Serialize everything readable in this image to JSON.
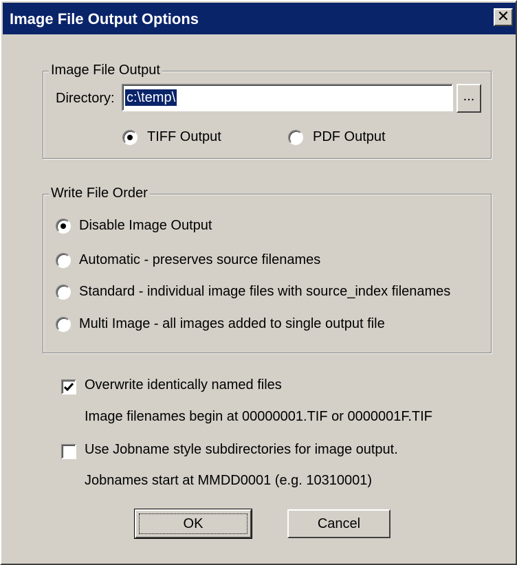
{
  "window": {
    "title": "Image File Output Options",
    "close_glyph": "✕"
  },
  "output_group": {
    "legend": "Image File Output",
    "directory_label": "Directory:",
    "directory_value": "c:\\temp\\",
    "browse_label": "...",
    "format_options": [
      {
        "label": "TIFF Output",
        "checked": true
      },
      {
        "label": "PDF Output",
        "checked": false
      }
    ]
  },
  "order_group": {
    "legend": "Write File Order",
    "options": [
      {
        "label": "Disable Image Output",
        "checked": true
      },
      {
        "label": "Automatic - preserves source filenames",
        "checked": false
      },
      {
        "label": "Standard - individual image files with source_index filenames",
        "checked": false
      },
      {
        "label": "Multi Image - all images added to single output file",
        "checked": false
      }
    ]
  },
  "overwrite": {
    "label": "Overwrite identically named files",
    "checked": true,
    "note": "Image filenames begin at 00000001.TIF or 0000001F.TIF"
  },
  "jobname": {
    "label": "Use Jobname style subdirectories for image output.",
    "checked": false,
    "note": "Jobnames start at MMDD0001 (e.g. 10310001)"
  },
  "buttons": {
    "ok_label": "OK",
    "cancel_label": "Cancel"
  },
  "colors": {
    "title_bar": "#0a246a",
    "dialog_face": "#d4d0c8",
    "selection": "#0a246a"
  }
}
